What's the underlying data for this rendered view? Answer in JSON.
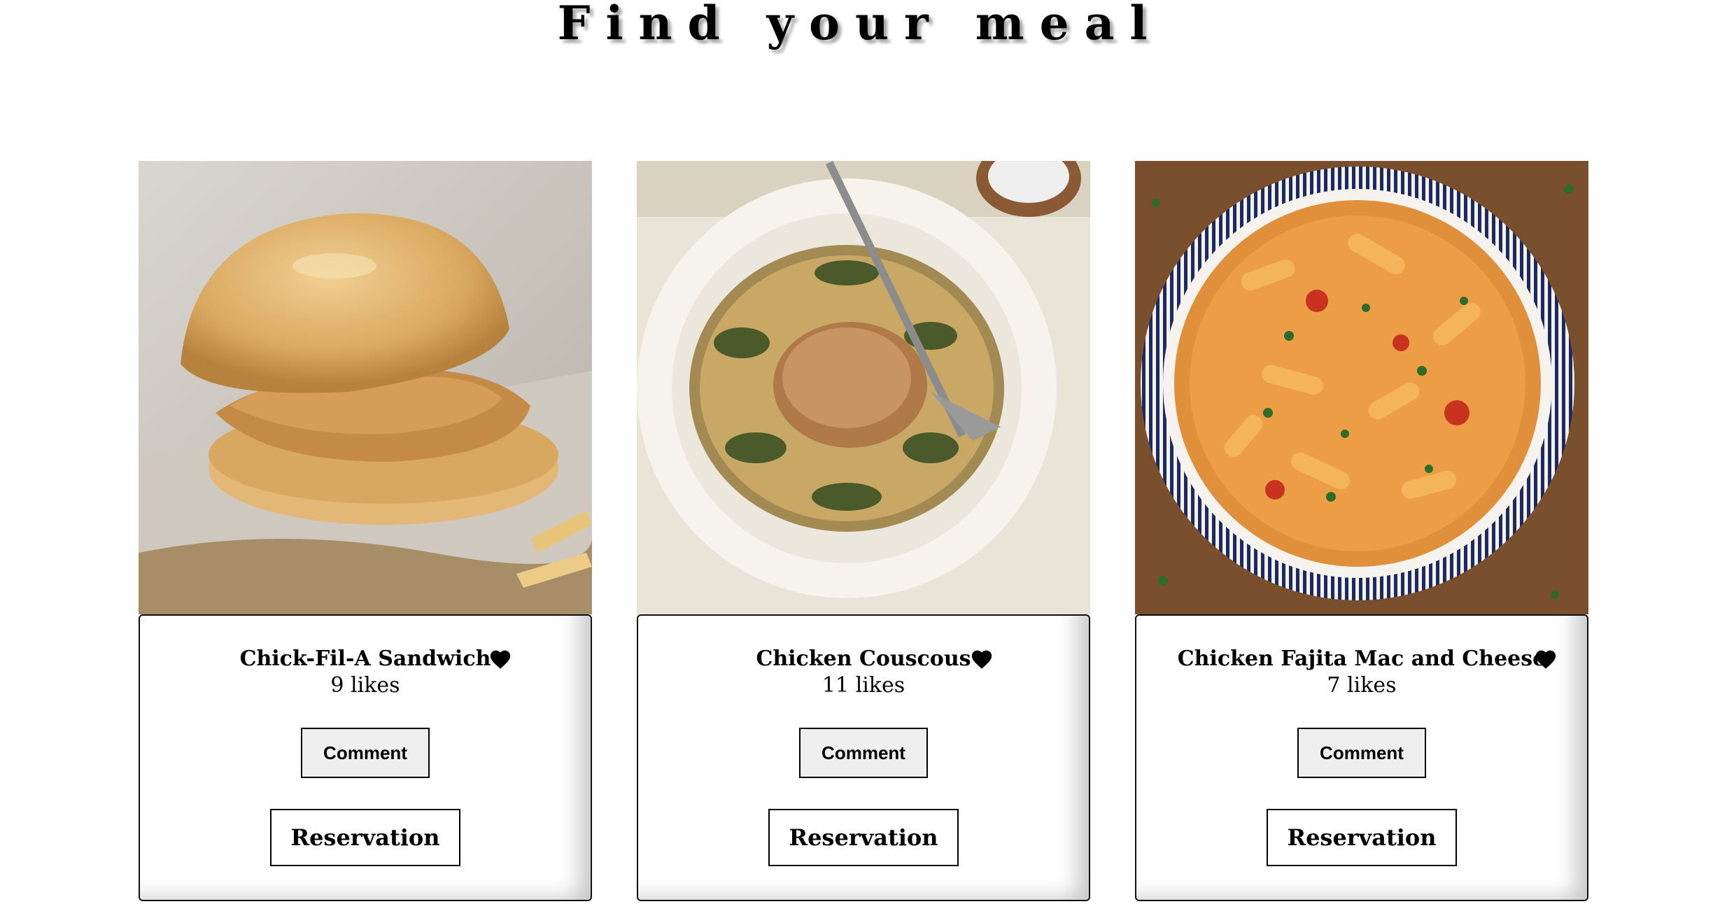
{
  "header": {
    "title": "Find your meal"
  },
  "meals": [
    {
      "name": "Chick-Fil-A Sandwich",
      "likes_count": "9",
      "likes_label": "likes",
      "comment_label": "Comment",
      "reservation_label": "Reservation",
      "image_icon": "chicken-sandwich-photo"
    },
    {
      "name": "Chicken Couscous",
      "likes_count": "11",
      "likes_label": "likes",
      "comment_label": "Comment",
      "reservation_label": "Reservation",
      "image_icon": "chicken-couscous-photo"
    },
    {
      "name": "Chicken Fajita Mac and Cheese",
      "likes_count": "7",
      "likes_label": "likes",
      "comment_label": "Comment",
      "reservation_label": "Reservation",
      "image_icon": "fajita-mac-and-cheese-photo"
    }
  ],
  "colors": {
    "background": "#ffffff",
    "text": "#000000",
    "comment_button_bg": "#efefef",
    "heart": "#000000"
  }
}
